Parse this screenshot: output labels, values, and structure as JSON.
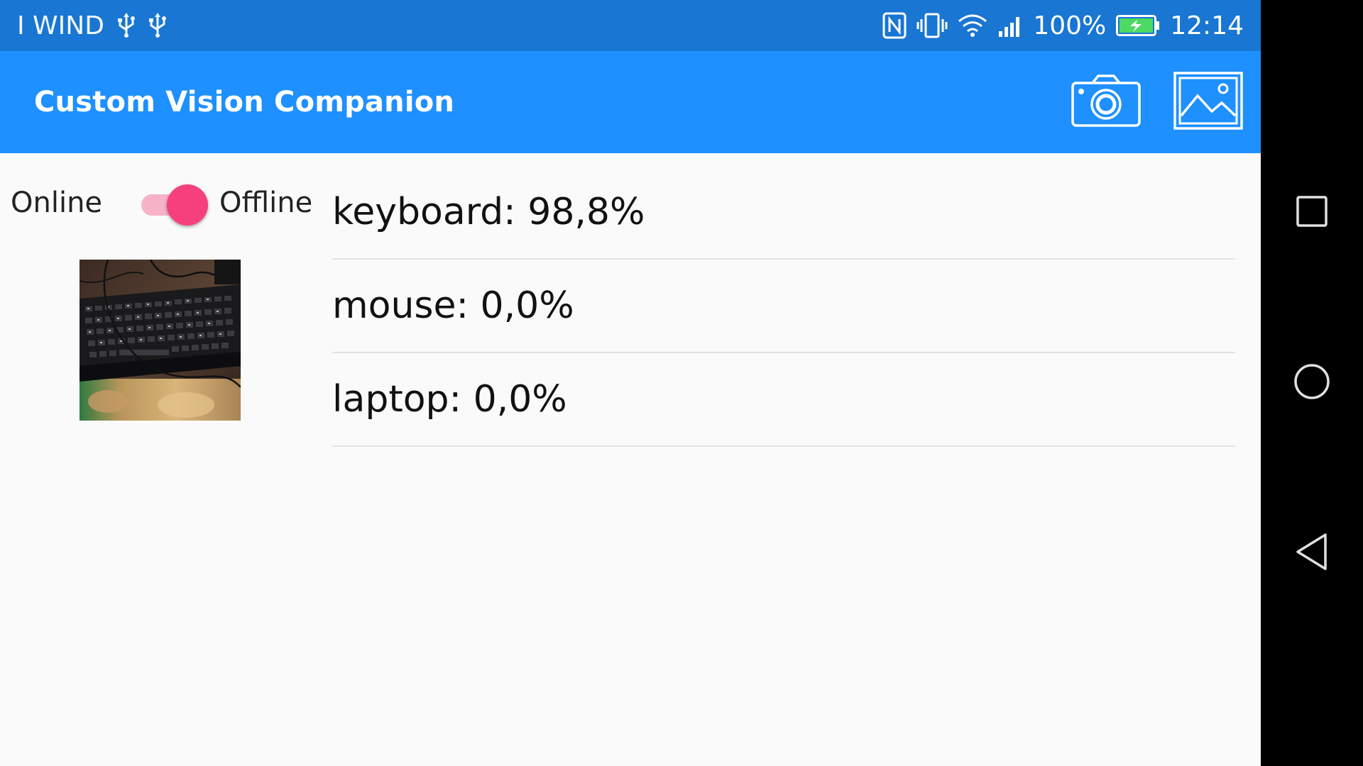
{
  "status_bar": {
    "carrier": "I WIND",
    "battery_percent": "100%",
    "time": "12:14"
  },
  "app_bar": {
    "title": "Custom Vision Companion",
    "camera_icon": "camera-icon",
    "gallery_icon": "image-gallery-icon"
  },
  "mode_switch": {
    "left_label": "Online",
    "right_label": "Offline",
    "state": "offline",
    "track_color": "#f6b3c8",
    "thumb_color": "#f63f7d"
  },
  "results": [
    {
      "label": "keyboard: 98,8%"
    },
    {
      "label": "mouse: 0,0%"
    },
    {
      "label": "laptop: 0,0%"
    }
  ],
  "colors": {
    "status_bar": "#1976d2",
    "app_bar": "#1e90ff",
    "background": "#fafafa",
    "nav_bar": "#000000"
  },
  "navigation": {
    "recents_icon": "square-recents-icon",
    "home_icon": "circle-home-icon",
    "back_icon": "triangle-back-icon"
  }
}
